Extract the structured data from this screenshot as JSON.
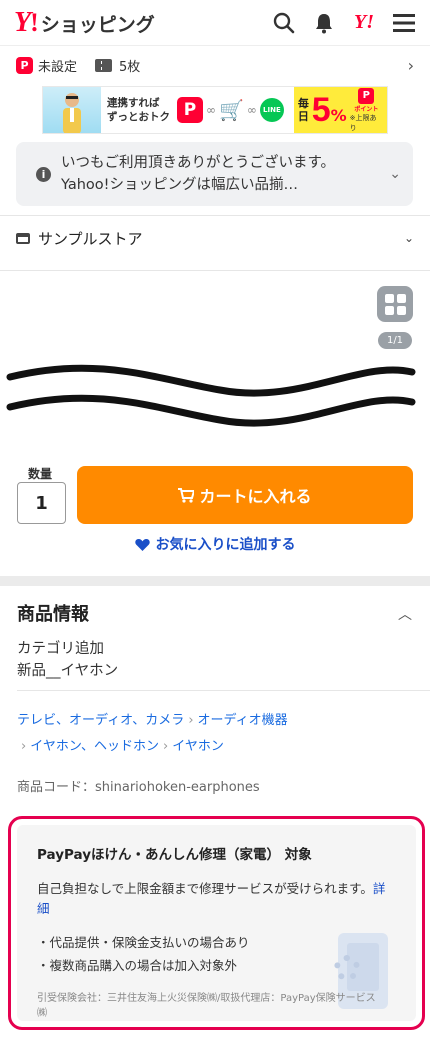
{
  "header": {
    "logo_y": "Y",
    "logo_ex": "!",
    "logo_text": "ショッピング",
    "icons": [
      "search-icon",
      "bell-icon",
      "yahoo-icon",
      "menu-icon"
    ],
    "yahoo_mark": "Y!"
  },
  "points": {
    "paypay_letter": "P",
    "paypay_status": "未設定",
    "coupon_count": "5枚"
  },
  "banner": {
    "line1": "連携すれば",
    "line2": "ずっとおトク",
    "paypay_letter": "P",
    "line_label": "LINE",
    "daily_word": "毎日",
    "percent_num": "5",
    "percent_sign": "%",
    "point_label": "ポイント",
    "note": "※上限あり"
  },
  "notice": {
    "line1": "いつもご利用頂きありがとうございます。",
    "line2": "Yahoo!ショッピングは幅広い品揃…"
  },
  "store": {
    "name": "サンプルストア"
  },
  "gallery": {
    "page_indicator": "1/1"
  },
  "cart": {
    "qty_label": "数量",
    "qty_value": "1",
    "add_to_cart": "カートに入れる",
    "favorite": "お気に入りに追加する"
  },
  "product_info": {
    "title": "商品情報",
    "category_line1": "カテゴリ追加",
    "category_line2": "新品__イヤホン",
    "breadcrumbs": [
      "テレビ、オーディオ、カメラ",
      "オーディオ機器",
      "イヤホン、ヘッドホン",
      "イヤホン"
    ],
    "item_code": "商品コード：shinariohoken-earphones"
  },
  "paypay_insurance": {
    "title": "PayPayほけん・あんしん修理（家電） 対象",
    "description": "自己負担なしで上限金額まで修理サービスが受けられます。",
    "more_link": "詳細",
    "bullets": [
      "・代品提供・保険金支払いの場合あり",
      "・複数商品購入の場合は加入対象外"
    ],
    "footer": "引受保険会社：三井住友海上火災保険㈱/取扱代理店：PayPay保険サービス㈱"
  },
  "colors": {
    "brand_red": "#ff0033",
    "cart_orange": "#ff8a00",
    "link_blue": "#1a4fc8",
    "insurance_border": "#e5004f"
  }
}
